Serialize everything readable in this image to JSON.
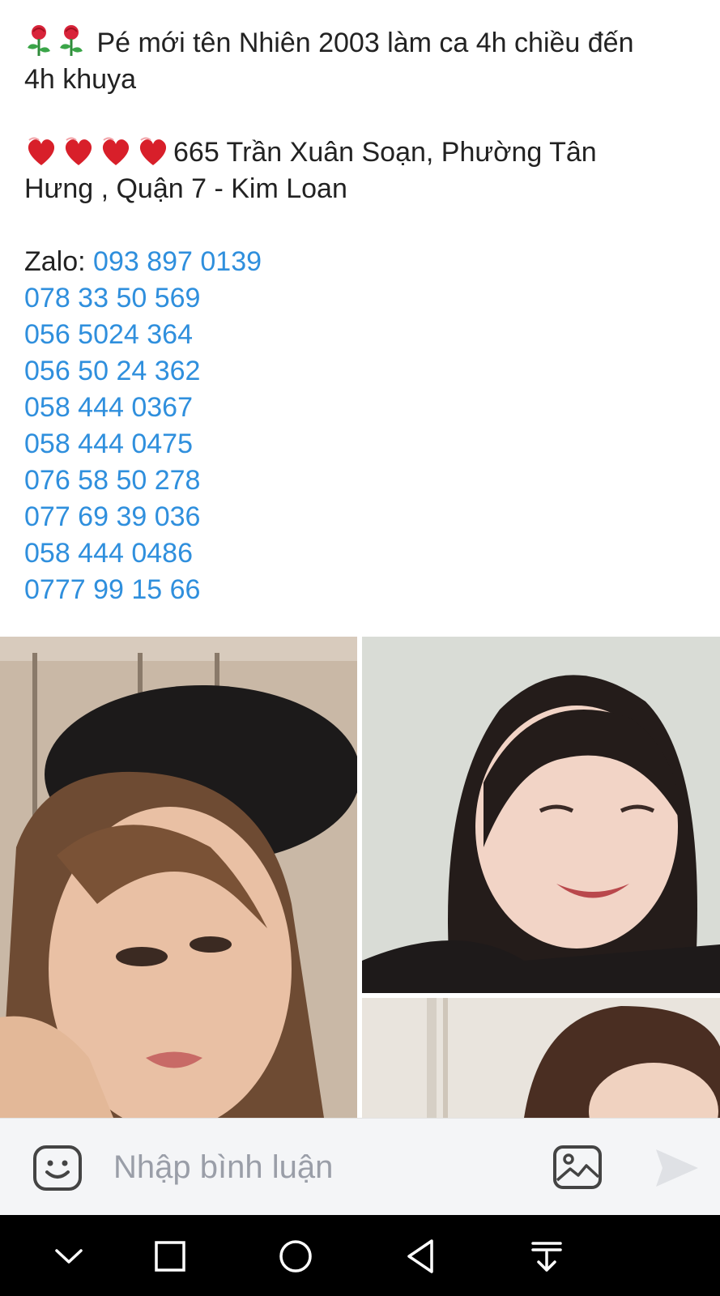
{
  "post": {
    "line1": "Pé mới tên Nhiên 2003 làm ca 4h chiều đến",
    "line2": "4h khuya",
    "address_line1": "665 Trần Xuân Soạn, Phường Tân",
    "address_line2": "Hưng , Quận 7 - Kim Loan",
    "zalo_label": "Zalo: ",
    "phones": [
      "093 897 0139",
      "078 33 50 569",
      "056 5024 364",
      "056 50 24 362",
      "058 444 0367",
      "058 444 0475",
      "076 58 50 278",
      "077 69 39 036",
      "058 444 0486",
      "0777 99 15 66"
    ]
  },
  "comment_bar": {
    "placeholder": "Nhập bình luận"
  },
  "icons": {
    "emoji": "smiley-icon",
    "image": "image-icon",
    "send": "send-icon",
    "rose": "rose-icon",
    "heart": "heart-icon"
  },
  "colors": {
    "link": "#2f8fdd",
    "text": "#222222",
    "comment_bar_bg": "#f4f5f7",
    "nav_bg": "#000000"
  }
}
